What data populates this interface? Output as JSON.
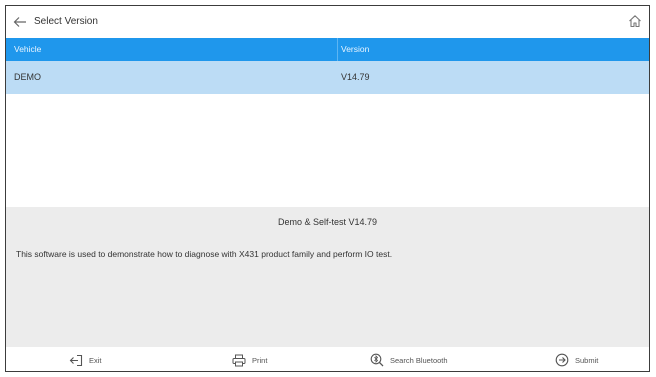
{
  "header": {
    "title": "Select Version"
  },
  "table": {
    "columns": [
      "Vehicle",
      "Version"
    ],
    "rows": [
      {
        "vehicle": "DEMO",
        "version": "V14.79",
        "selected": true
      }
    ]
  },
  "info": {
    "title": "Demo & Self-test V14.79",
    "description": "This software is used to demonstrate how to diagnose with X431 product family and perform IO test."
  },
  "footer": {
    "exit_label": "Exit",
    "print_label": "Print",
    "search_bluetooth_label": "Search Bluetooth",
    "submit_label": "Submit"
  },
  "icons": {
    "back": "back-arrow-icon",
    "home": "home-icon",
    "exit": "exit-icon",
    "print": "printer-icon",
    "search_bluetooth": "bluetooth-search-icon",
    "submit": "submit-arrow-icon"
  },
  "colors": {
    "header_blue": "#1f97ec",
    "selected_row": "#bcdcf5",
    "info_panel": "#ececec"
  }
}
